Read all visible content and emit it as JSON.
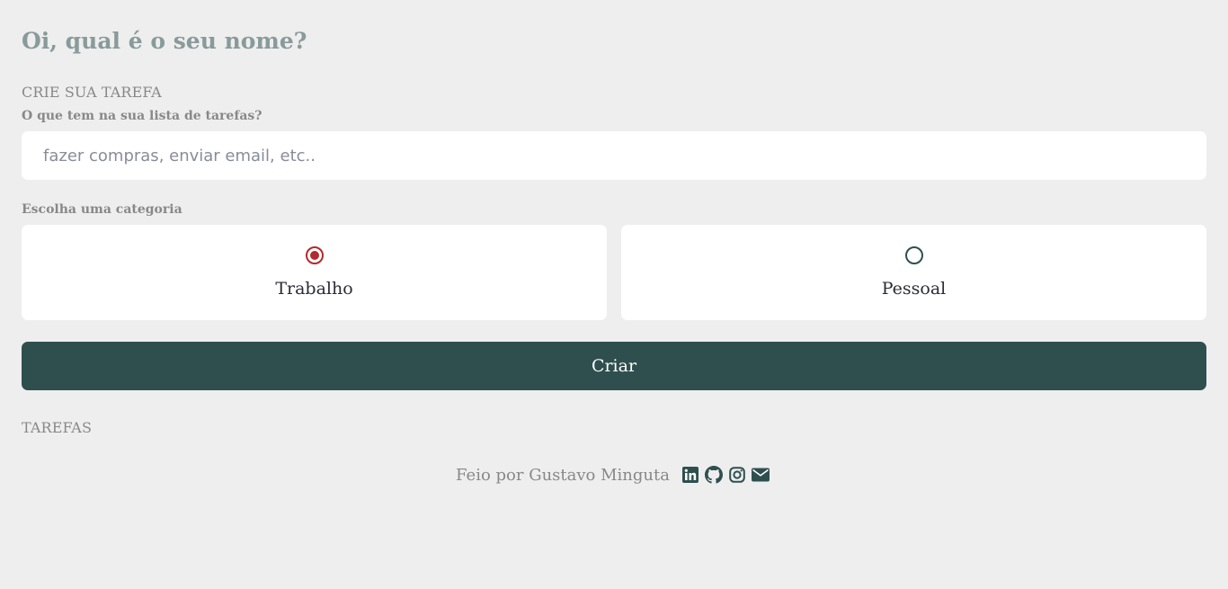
{
  "header": {
    "greeting": "Oi, qual é o seu nome?"
  },
  "create_section": {
    "title": "CRIE SUA TAREFA",
    "task_label": "O que tem na sua lista de tarefas?",
    "task_placeholder": "fazer compras, enviar email, etc..",
    "task_value": "",
    "category_label": "Escolha uma categoria",
    "categories": [
      {
        "label": "Trabalho",
        "selected": true
      },
      {
        "label": "Pessoal",
        "selected": false
      }
    ],
    "create_button_label": "Criar"
  },
  "tasks_section": {
    "title": "TAREFAS"
  },
  "footer": {
    "text": "Feio por Gustavo Minguta",
    "social_icons": [
      "linkedin-icon",
      "github-icon",
      "instagram-icon",
      "email-icon"
    ]
  },
  "colors": {
    "background": "#eeeeee",
    "accent": "#2f4f4f",
    "selected_radio": "#b22a2e",
    "greeting": "#899a9a",
    "muted_text": "#888888"
  }
}
